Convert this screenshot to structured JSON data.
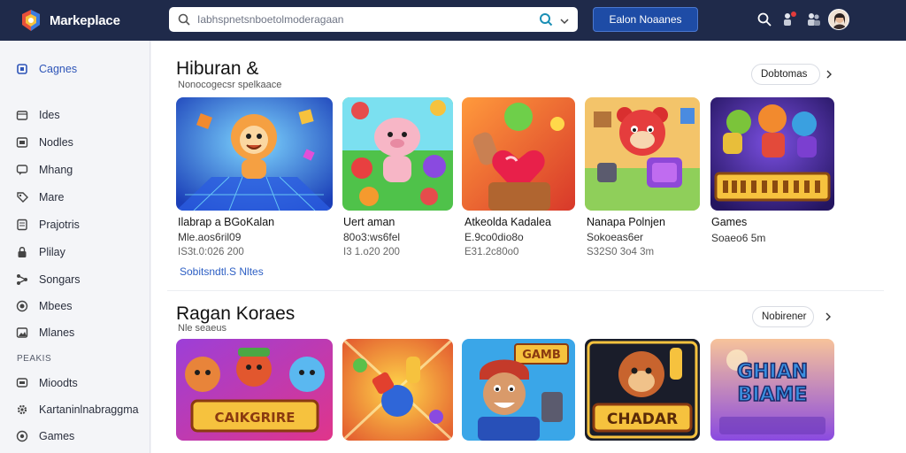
{
  "app": {
    "name": "Markeplace"
  },
  "search": {
    "placeholder": "Iabhspnetsnboetolmoderagaan"
  },
  "header": {
    "action_label": "Ealon Noaanes"
  },
  "sidebar": {
    "items": [
      {
        "label": "Cagnes",
        "icon": "square-icon",
        "active": true
      },
      {
        "label": "Ides",
        "icon": "folder-icon"
      },
      {
        "label": "Nodles",
        "icon": "grid-icon"
      },
      {
        "label": "Mhang",
        "icon": "chat-icon"
      },
      {
        "label": "Mare",
        "icon": "tag-icon"
      },
      {
        "label": "Prajotris",
        "icon": "document-icon"
      },
      {
        "label": "Plilay",
        "icon": "lock-icon"
      },
      {
        "label": "Songars",
        "icon": "share-icon"
      },
      {
        "label": "Mbees",
        "icon": "circle-icon"
      },
      {
        "label": "Mlanes",
        "icon": "image-icon"
      }
    ],
    "section_label": "PEAKIS",
    "section_items": [
      {
        "label": "Mioodts",
        "icon": "chat-icon"
      },
      {
        "label": "Kartaninlnabraggma",
        "icon": "gear-icon"
      },
      {
        "label": "Games",
        "icon": "circle-icon"
      }
    ]
  },
  "sections": [
    {
      "title": "Hiburan &",
      "subtitle": "Nonocogecsr spelkaace",
      "more_label": "Dobtomas",
      "cards": [
        {
          "title": "Ilabrap a BGoKalan",
          "line2": "Mle.aos6ril09",
          "meta": "IS3t.0:026 200",
          "link": "Sobitsndtl.S Nltes",
          "art": "fox-arena"
        },
        {
          "title": "Uert aman",
          "line2": "80o3:ws6fel",
          "meta": "I3 1.o20 200",
          "art": "pig-party"
        },
        {
          "title": "Atkeolda Kadalea",
          "line2": "E.9co0dio8o",
          "meta": "E31.2c80o0",
          "art": "heart-hero"
        },
        {
          "title": "Nanapa Polnjen",
          "line2": "Sokoeas6er",
          "meta": "S32S0 3o4 3m",
          "art": "red-bear"
        },
        {
          "title": "Games",
          "line2": "Soaeo6 5m",
          "meta": "",
          "art": "brawl-logo"
        }
      ]
    },
    {
      "title": "Ragan Koraes",
      "subtitle": "Nle seaeus",
      "more_label": "Nobirener",
      "cards": [
        {
          "art": "cat-crew",
          "overlay": "CAIKGRIRE"
        },
        {
          "art": "rocket-hero"
        },
        {
          "art": "gamer-guy",
          "overlay": "GAMB"
        },
        {
          "art": "monkey-king",
          "overlay": "CHADAR"
        },
        {
          "art": "title-logo",
          "overlay": "GHIAN BIAME"
        }
      ]
    }
  ],
  "colors": {
    "topbar": "#1f2a4a",
    "accent": "#2e55b8",
    "button": "#1e4ca6"
  }
}
